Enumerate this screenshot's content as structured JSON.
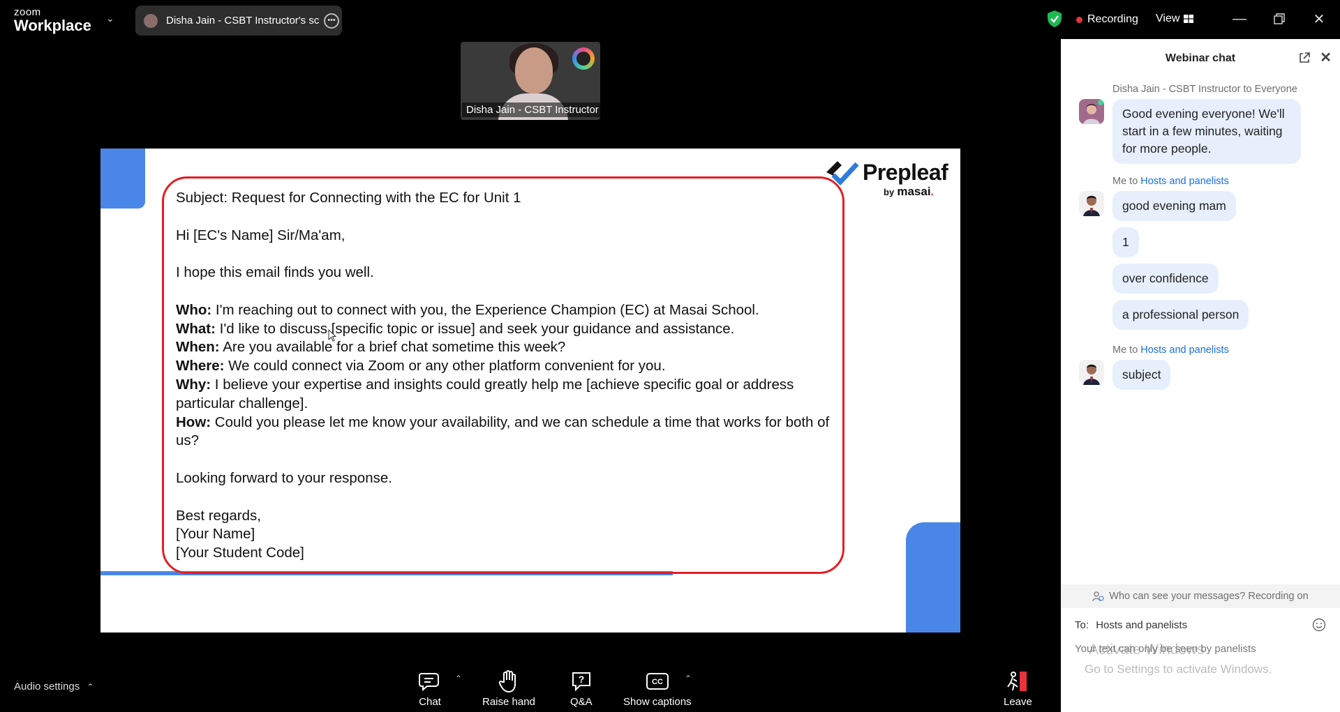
{
  "app": {
    "logo_small": "zoom",
    "logo_big": "Workplace",
    "share_title": "Disha Jain - CSBT Instructor's scre",
    "recording_label": "Recording",
    "view_label": "View",
    "accent_green": "#1fb954",
    "recording_red": "#e8323c"
  },
  "video": {
    "participant_name": "Disha Jain - CSBT Instructor"
  },
  "slide": {
    "brand_name": "Prepleaf",
    "brand_by": "by",
    "brand_sub": "masai",
    "subject": "Subject: Request for Connecting with the EC for Unit 1",
    "greeting": "Hi [EC's Name] Sir/Ma'am,",
    "opening": "I hope this email finds you well.",
    "who_label": "Who:",
    "who_text": " I'm reaching out to connect with you, the Experience Champion (EC) at Masai School.",
    "what_label": "What:",
    "what_text": " I'd like to discuss [specific topic or issue] and seek your guidance and assistance.",
    "when_label": "When:",
    "when_text": " Are you available for a brief chat sometime this week?",
    "where_label": "Where:",
    "where_text": " We could connect via Zoom or any other platform convenient for you.",
    "why_label": "Why:",
    "why_text": " I believe your expertise and insights could greatly help me [achieve specific goal or address particular challenge].",
    "how_label": "How:",
    "how_text": " Could you please let me know your availability, and we can schedule a time that works for both of us?",
    "closing": "Looking forward to your response.",
    "regards": "Best regards,",
    "name_placeholder": "[Your Name]",
    "code_placeholder": "[Your Student Code]"
  },
  "toolbar": {
    "audio_settings": "Audio settings",
    "chat": "Chat",
    "raise_hand": "Raise hand",
    "qa": "Q&A",
    "show_captions": "Show captions",
    "leave": "Leave",
    "leave_red": "#e8323c"
  },
  "chat": {
    "title": "Webinar chat",
    "messages": [
      {
        "meta_sender": "Disha Jain - CSBT Instructor to Everyone",
        "meta_target": "",
        "bubbles": [
          "Good evening everyone! We'll start in a few minutes, waiting for more people."
        ]
      },
      {
        "meta_sender": "Me to ",
        "meta_target": "Hosts and panelists",
        "bubbles": [
          "good evening mam",
          "1",
          "over confidence",
          "a professional person"
        ]
      },
      {
        "meta_sender": "Me to ",
        "meta_target": "Hosts and panelists",
        "bubbles": [
          "subject"
        ]
      }
    ],
    "privacy_note": "Who can see your messages? Recording on",
    "to_label": "To:",
    "to_value": "Hosts and panelists",
    "hint": "Your text can only be seen by panelists",
    "watermark_title": "Activate Windows",
    "watermark_sub": "Go to Settings to activate Windows."
  }
}
